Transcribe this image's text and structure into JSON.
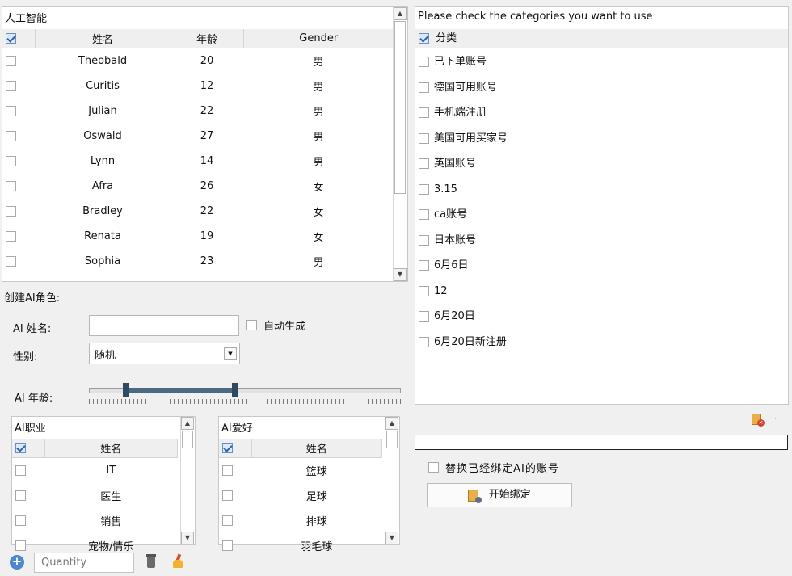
{
  "ai_table": {
    "title": "人工智能",
    "columns": [
      "姓名",
      "年龄",
      "Gender"
    ],
    "rows": [
      {
        "name": "Theobald",
        "age": "20",
        "gender": "男"
      },
      {
        "name": "Curitis",
        "age": "12",
        "gender": "男"
      },
      {
        "name": "Julian",
        "age": "22",
        "gender": "男"
      },
      {
        "name": "Oswald",
        "age": "27",
        "gender": "男"
      },
      {
        "name": "Lynn",
        "age": "14",
        "gender": "男"
      },
      {
        "name": "Afra",
        "age": "26",
        "gender": "女"
      },
      {
        "name": "Bradley",
        "age": "22",
        "gender": "女"
      },
      {
        "name": "Renata",
        "age": "19",
        "gender": "女"
      },
      {
        "name": "Sophia",
        "age": "23",
        "gender": "男"
      }
    ]
  },
  "create": {
    "title": "创建AI角色:",
    "name_label": "AI 姓名:",
    "name_value": "",
    "auto_generate_label": "自动生成",
    "gender_label": "性别:",
    "gender_value": "随机",
    "age_label": "AI 年龄:",
    "age_range_fraction": [
      0.12,
      0.47
    ]
  },
  "job_list": {
    "title": "AI职业",
    "header": "姓名",
    "items": [
      "IT",
      "医生",
      "销售",
      "宠物/情乐"
    ]
  },
  "hobby_list": {
    "title": "AI爱好",
    "header": "姓名",
    "items": [
      "篮球",
      "足球",
      "排球",
      "羽毛球"
    ]
  },
  "bottom_bar": {
    "quantity_placeholder": "Quantity"
  },
  "categories": {
    "title": "Please check the categories you want to use",
    "header": "分类",
    "items": [
      "已下单账号",
      "德国可用账号",
      "手机端注册",
      "美国可用买家号",
      "英国账号",
      "3.15",
      "ca账号",
      "日本账号",
      "6月6日",
      "12",
      "6月20日",
      "6月20日新注册"
    ]
  },
  "bind": {
    "replace_label": "替换已经绑定AI的账号",
    "start_button": "开始绑定"
  },
  "colors": {
    "accent_blue": "#3b78c4",
    "slider_dark": "#2f4a60",
    "slider_fill": "#4a6a82"
  }
}
